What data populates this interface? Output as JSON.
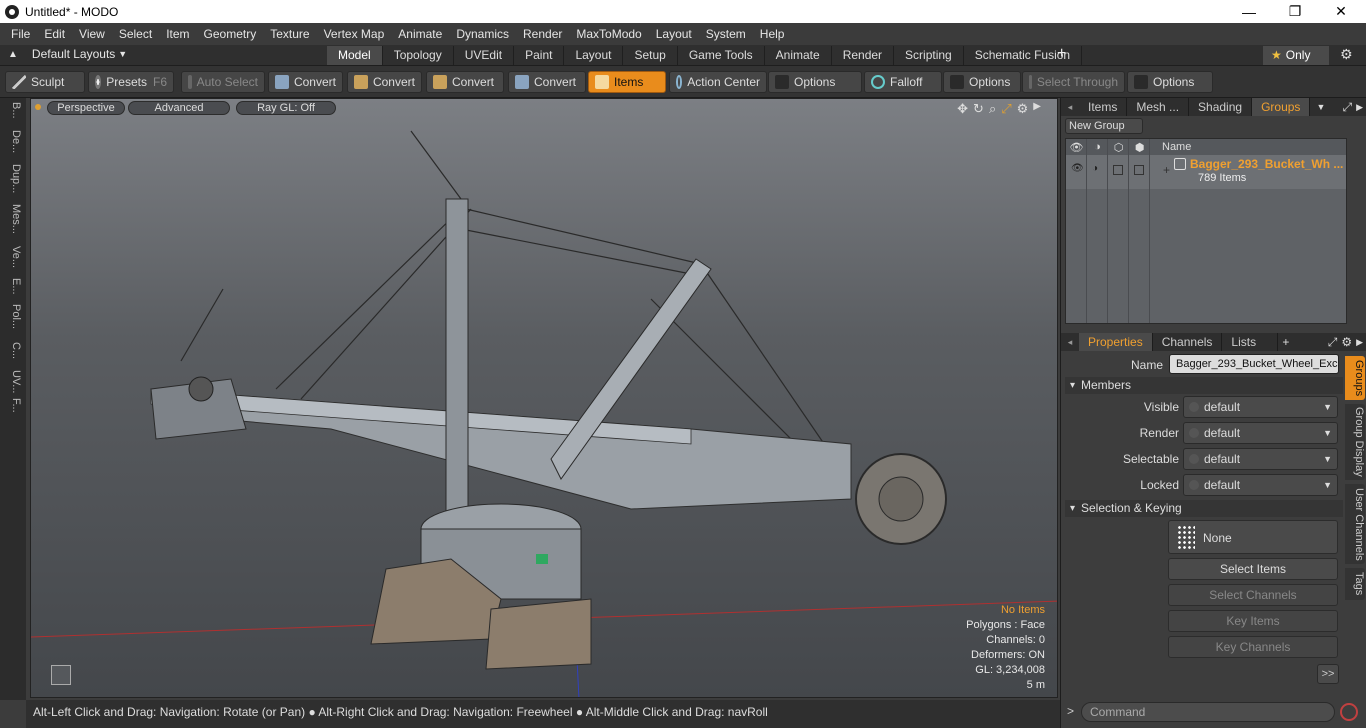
{
  "window": {
    "title": "Untitled* - MODO",
    "min": "—",
    "max": "❐",
    "close": "✕"
  },
  "menu": [
    "File",
    "Edit",
    "View",
    "Select",
    "Item",
    "Geometry",
    "Texture",
    "Vertex Map",
    "Animate",
    "Dynamics",
    "Render",
    "MaxToModo",
    "Layout",
    "System",
    "Help"
  ],
  "layouts": {
    "current": "Default Layouts",
    "tabs": [
      "Model",
      "Topology",
      "UVEdit",
      "Paint",
      "Layout",
      "Setup",
      "Game Tools",
      "Animate",
      "Render",
      "Scripting",
      "Schematic Fusion"
    ],
    "active": "Model",
    "only": "Only"
  },
  "toolbar": {
    "sculpt": "Sculpt",
    "presets": "Presets",
    "presets_key": "F6",
    "auto_select": "Auto Select",
    "convert1": "Convert",
    "convert2": "Convert",
    "convert3": "Convert",
    "convert4": "Convert",
    "items": "Items",
    "action_center": "Action Center",
    "options1": "Options",
    "falloff": "Falloff",
    "options2": "Options",
    "select_through": "Select Through",
    "options3": "Options"
  },
  "lefttabs": [
    "B...",
    "De...",
    "Dup...",
    "Mes...",
    "Ve...",
    "E...",
    "Pol...",
    "C...",
    "UV...",
    "F..."
  ],
  "viewport": {
    "perspective": "Perspective",
    "advanced": "Advanced",
    "raygl": "Ray GL: Off",
    "info": {
      "no_items": "No Items",
      "polygons": "Polygons : Face",
      "channels": "Channels: 0",
      "deformers": "Deformers: ON",
      "gl": "GL: 3,234,008",
      "scale": "5 m"
    }
  },
  "status": "Alt-Left Click and Drag: Navigation: Rotate (or Pan) ● Alt-Right Click and Drag: Navigation: Freewheel ● Alt-Middle Click and Drag: navRoll",
  "panel_tabs": [
    "Items",
    "Mesh ...",
    "Shading",
    "Groups"
  ],
  "panel_active": "Groups",
  "groups": {
    "new_group": "New Group",
    "name_header": "Name",
    "group_name": "Bagger_293_Bucket_Wh ...",
    "group_count": "789 Items"
  },
  "props_tabs": [
    "Properties",
    "Channels",
    "Lists"
  ],
  "props_active": "Properties",
  "props": {
    "name_label": "Name",
    "name_value": "Bagger_293_Bucket_Wheel_Exca",
    "members": "Members",
    "visible_label": "Visible",
    "visible": "default",
    "render_label": "Render",
    "render": "default",
    "selectable_label": "Selectable",
    "selectable": "default",
    "locked_label": "Locked",
    "locked": "default",
    "sel_keying": "Selection & Keying",
    "none": "None",
    "select_items": "Select Items",
    "select_channels": "Select Channels",
    "key_items": "Key Items",
    "key_channels": "Key Channels",
    "more": ">>"
  },
  "right_vtabs": [
    "Groups",
    "Group Display",
    "User Channels",
    "Tags"
  ],
  "command": {
    "placeholder": "Command"
  }
}
